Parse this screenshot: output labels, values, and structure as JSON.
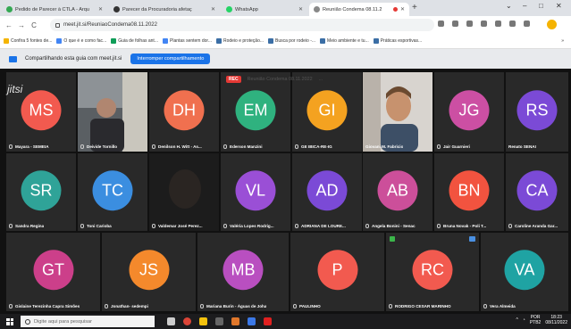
{
  "browser": {
    "tabs": [
      {
        "label": "Pedido de Parecer à CTLA - Arqu",
        "icon_color": "#34a853"
      },
      {
        "label": "Parecer da Procuradoria afetaç",
        "icon_color": "#333333"
      },
      {
        "label": "WhatsApp",
        "icon_color": "#25d366"
      },
      {
        "label": "Reunião Condema 08.11.2",
        "icon_color": "#888888"
      }
    ],
    "url": "meet.jit.si/ReuniaoCondema08.11.2022",
    "window_controls": [
      "⌄",
      "–",
      "□",
      "✕"
    ]
  },
  "bookmarks": [
    {
      "label": "Confira 5 fontes de...",
      "color": "#f4b400"
    },
    {
      "label": "O que é e como fac...",
      "color": "#4285f4"
    },
    {
      "label": "Guia de folhas ant...",
      "color": "#0f9d58"
    },
    {
      "label": "Plantas sentem dor...",
      "color": "#4285f4"
    },
    {
      "label": "Rodeio e proteção...",
      "color": "#3b6ea5"
    },
    {
      "label": "Busca por rodeio -...",
      "color": "#3b6ea5"
    },
    {
      "label": "Meio ambiente e tu...",
      "color": "#3b6ea5"
    },
    {
      "label": "Práticas esportivas...",
      "color": "#3b6ea5"
    }
  ],
  "share_bar": {
    "message": "Compartilhando esta guia com meet.jit.si",
    "stop_button": "Interromper compartilhamento"
  },
  "meeting": {
    "logo": "jitsi",
    "rec_badge": "REC",
    "title": "Reunião Condema 08.11.2022",
    "time": "...",
    "participants": [
      {
        "initials": "MS",
        "name": "Mayara - SEMEIA",
        "color": "#f25a4f"
      },
      {
        "initials": "",
        "name": "Deivide Tornillo",
        "color": "#3a3a3a",
        "video": true
      },
      {
        "initials": "DH",
        "name": "Denilson H. Witt - As...",
        "color": "#f0704f"
      },
      {
        "initials": "EM",
        "name": "Ederson Manzini",
        "color": "#2fb27f"
      },
      {
        "initials": "GI",
        "name": "GE IBICA-RE-IG",
        "color": "#f4a220"
      },
      {
        "initials": "",
        "name": "Giovani M. Fabricio",
        "color": "#3a3a3a",
        "video": true
      },
      {
        "initials": "JG",
        "name": "Jair Guarnieri",
        "color": "#cc4fa3"
      },
      {
        "initials": "RS",
        "name": "Renato SENAI",
        "color": "#7b4ad6"
      },
      {
        "initials": "SR",
        "name": "Sandra Regina",
        "color": "#2fa398"
      },
      {
        "initials": "TC",
        "name": "Toni Carioba",
        "color": "#3b8ee0"
      },
      {
        "initials": "",
        "name": "Valdemar José Perez...",
        "color": "#222222",
        "video": true
      },
      {
        "initials": "VL",
        "name": "Valéria Lopes Rodrig...",
        "color": "#9a4fd6"
      },
      {
        "initials": "AD",
        "name": "ADRIANA DE LOURE...",
        "color": "#7b4ad6"
      },
      {
        "initials": "AB",
        "name": "Angela Bonini - Senac",
        "color": "#cc4f9a"
      },
      {
        "initials": "BN",
        "name": "Bruna Novak - Poli T...",
        "color": "#f2533f"
      },
      {
        "initials": "CA",
        "name": "Caroline Aranda Gar...",
        "color": "#7b4ad6"
      },
      {
        "initials": "GT",
        "name": "Gislaine Terezinha Capra Simões",
        "color": "#cc3f8a"
      },
      {
        "initials": "JS",
        "name": "Jonathan- sedempi",
        "color": "#f4892c"
      },
      {
        "initials": "MB",
        "name": "Mariana Burin - Águas de Joha",
        "color": "#b94fc0"
      },
      {
        "initials": "P",
        "name": "PAULINHO",
        "color": "#f25a4f"
      },
      {
        "initials": "RC",
        "name": "RODRIGO CESAR MARINHO",
        "color": "#f25a4f"
      },
      {
        "initials": "VA",
        "name": "Vera Almeida",
        "color": "#1fa3a3"
      }
    ]
  },
  "taskbar": {
    "search_placeholder": "Digite aqui para pesquisar",
    "lang_top": "POR",
    "lang_bottom": "PTB2",
    "time": "18:23",
    "date": "08/11/2022",
    "apps": [
      {
        "name": "task-view",
        "color": "#cccccc"
      },
      {
        "name": "chrome",
        "color": "#db4437"
      },
      {
        "name": "file-explorer",
        "color": "#f4c20d"
      },
      {
        "name": "calculator",
        "color": "#666666"
      },
      {
        "name": "app-orange",
        "color": "#e0772b"
      },
      {
        "name": "app-blue",
        "color": "#3b78e7"
      },
      {
        "name": "acrobat",
        "color": "#e02020"
      }
    ]
  }
}
